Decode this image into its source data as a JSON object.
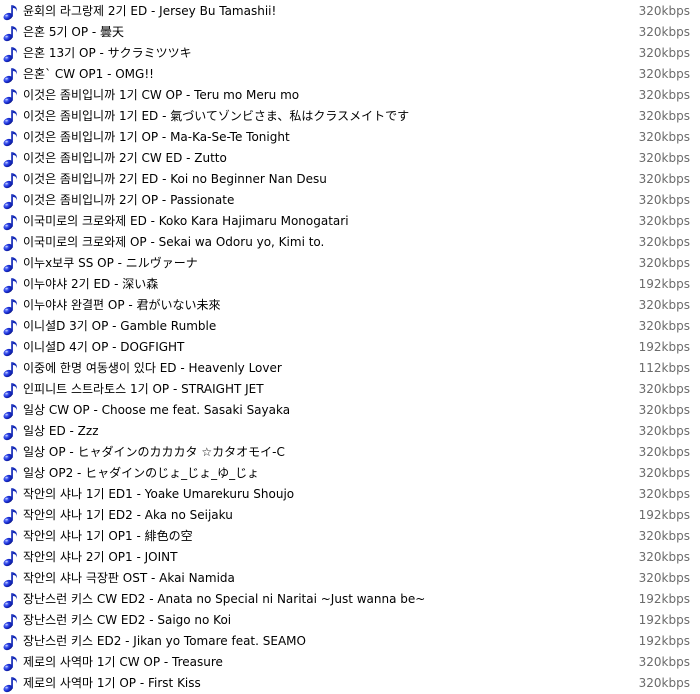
{
  "icon": "music-note-icon",
  "colors": {
    "note_blue": "#1a2fd8",
    "bitrate_gray": "#6b6b6b"
  },
  "tracks": [
    {
      "title": "윤회의 라그랑제 2기 ED - Jersey Bu Tamashii!",
      "bitrate": "320kbps"
    },
    {
      "title": "은혼 5기 OP - 曇天",
      "bitrate": "320kbps"
    },
    {
      "title": "은혼 13기 OP - サクラミツツキ",
      "bitrate": "320kbps"
    },
    {
      "title": "은혼` CW OP1 - OMG!!",
      "bitrate": "320kbps"
    },
    {
      "title": "이것은 좀비입니까 1기 CW OP - Teru mo Meru mo",
      "bitrate": "320kbps"
    },
    {
      "title": "이것은 좀비입니까 1기 ED - 氣づいてゾンビさま、私はクラスメイトです",
      "bitrate": "320kbps"
    },
    {
      "title": "이것은 좀비입니까 1기 OP - Ma-Ka-Se-Te Tonight",
      "bitrate": "320kbps"
    },
    {
      "title": "이것은 좀비입니까 2기 CW ED - Zutto",
      "bitrate": "320kbps"
    },
    {
      "title": "이것은 좀비입니까 2기 ED - Koi no Beginner Nan Desu",
      "bitrate": "320kbps"
    },
    {
      "title": "이것은 좀비입니까 2기 OP - Passionate",
      "bitrate": "320kbps"
    },
    {
      "title": "이국미로의 크로와제 ED - Koko Kara Hajimaru Monogatari",
      "bitrate": "320kbps"
    },
    {
      "title": "이국미로의 크로와제 OP - Sekai wa Odoru yo, Kimi to.",
      "bitrate": "320kbps"
    },
    {
      "title": "이누x보쿠 SS OP - ニルヴァーナ",
      "bitrate": "320kbps"
    },
    {
      "title": "이누야샤 2기 ED - 深い森",
      "bitrate": "192kbps"
    },
    {
      "title": "이누야샤 완결편 OP - 君がいない未來",
      "bitrate": "320kbps"
    },
    {
      "title": "이니셜D 3기 OP - Gamble Rumble",
      "bitrate": "320kbps"
    },
    {
      "title": "이니셜D 4기 OP - DOGFIGHT",
      "bitrate": "192kbps"
    },
    {
      "title": "이중에 한명 여동생이 있다 ED - Heavenly Lover",
      "bitrate": "112kbps"
    },
    {
      "title": "인피니트 스트라토스 1기 OP - STRAIGHT JET",
      "bitrate": "320kbps"
    },
    {
      "title": "일상 CW OP - Choose me feat. Sasaki Sayaka",
      "bitrate": "320kbps"
    },
    {
      "title": "일상 ED - Zzz",
      "bitrate": "320kbps"
    },
    {
      "title": "일상 OP - ヒャダインのカカカタ ☆カタオモイ-C",
      "bitrate": "320kbps"
    },
    {
      "title": "일상 OP2 - ヒャダインのじょ_じょ_ゆ_じょ",
      "bitrate": "320kbps"
    },
    {
      "title": "작안의 샤나 1기 ED1 - Yoake Umarekuru Shoujo",
      "bitrate": "320kbps"
    },
    {
      "title": "작안의 샤나 1기 ED2 - Aka no Seijaku",
      "bitrate": "192kbps"
    },
    {
      "title": "작안의 샤나 1기 OP1 - 緋色の空",
      "bitrate": "320kbps"
    },
    {
      "title": "작안의 샤나 2기 OP1 - JOINT",
      "bitrate": "320kbps"
    },
    {
      "title": "작안의 샤나 극장판 OST - Akai Namida",
      "bitrate": "320kbps"
    },
    {
      "title": "장난스런 키스 CW ED2 - Anata no Special ni Naritai ~Just wanna be~",
      "bitrate": "192kbps"
    },
    {
      "title": "장난스런 키스 CW ED2 - Saigo no Koi",
      "bitrate": "192kbps"
    },
    {
      "title": "장난스런 키스 ED2 - Jikan yo Tomare feat. SEAMO",
      "bitrate": "192kbps"
    },
    {
      "title": "제로의 사역마 1기 CW OP - Treasure",
      "bitrate": "320kbps"
    },
    {
      "title": "제로의 사역마 1기 OP - First Kiss",
      "bitrate": "320kbps"
    }
  ]
}
